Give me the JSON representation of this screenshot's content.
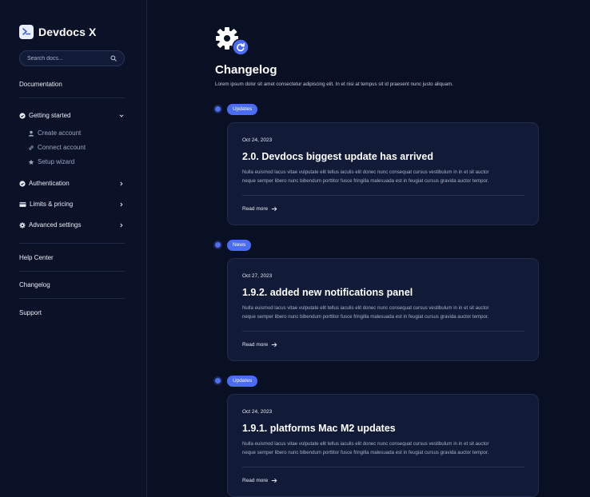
{
  "sidebar": {
    "brand": "Devdocs X",
    "search_placeholder": "Search docs...",
    "documentation": "Documentation",
    "groups": [
      {
        "label": "Getting started",
        "icon": "check-circle-icon",
        "expanded": true
      },
      {
        "label": "Authentication",
        "icon": "check-circle-icon",
        "expanded": false
      },
      {
        "label": "Limits & pricing",
        "icon": "credit-card-icon",
        "expanded": false
      },
      {
        "label": "Advanced settings",
        "icon": "gear-icon",
        "expanded": false
      }
    ],
    "sub_items": [
      {
        "label": "Create account",
        "icon": "user-icon"
      },
      {
        "label": "Connect account",
        "icon": "link-icon"
      },
      {
        "label": "Setup wizard",
        "icon": "star-icon"
      }
    ],
    "links": [
      "Help Center",
      "Changelog",
      "Support"
    ]
  },
  "header": {
    "title": "Changelog",
    "description": "Lorem ipsum dolor sit amet consectetur adipiscing elit. In et nisi at tempus sit id praesent nunc justo aliquam."
  },
  "entries": [
    {
      "badge": "Updates",
      "date": "Oct 24, 2023",
      "title": "2.0. Devdocs biggest update has arrived",
      "body_line1": "Nulla euismod lacus vitae vulputate elit tellus iaculis elit donec nunc consequat cursus vestibulum in in et sit auctor",
      "body_line2": "neque semper libero nunc bibendum porttitor fusce fringilla malesuada est in feugiat cursus gravida auctor tempor.",
      "link": "Read more"
    },
    {
      "badge": "News",
      "date": "Oct 27, 2023",
      "title": "1.9.2. added new notifications panel",
      "body_line1": "Nulla euismod lacus vitae vulputate elit tellus iaculis elit donec nunc consequat cursus vestibulum in in et sit auctor",
      "body_line2": "neque semper libero nunc bibendum porttitor fusce fringilla malesuada est in feugiat cursus gravida auctor tempor.",
      "link": "Read more"
    },
    {
      "badge": "Updates",
      "date": "Oct 24, 2023",
      "title": "1.9.1. platforms Mac M2 updates",
      "body_line1": "Nulla euismod lacus vitae vulputate elit tellus iaculis elit donec nunc consequat cursus vestibulum in in et sit auctor",
      "body_line2": "neque semper libero nunc bibendum porttitor fusce fringilla malesuada est in feugiat cursus gravida auctor tempor.",
      "link": "Read more"
    }
  ],
  "colors": {
    "background": "#0a1024",
    "card": "#111a36",
    "accent": "#4a6cf2"
  }
}
